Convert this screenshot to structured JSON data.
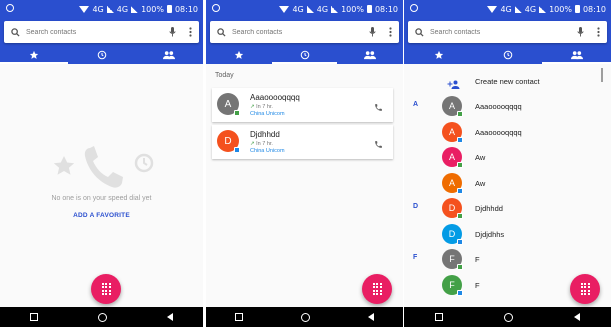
{
  "screens": {
    "speed_dial": {
      "status": {
        "network1": "4G",
        "network2": "4G",
        "battery": "100%",
        "time": "08:10"
      },
      "search": {
        "placeholder": "Search contacts"
      },
      "empty_message": "No one is on your speed dial yet",
      "add_favorite": "ADD A FAVORITE"
    },
    "recents": {
      "status": {
        "network1": "4G",
        "network2": "4G",
        "battery": "100%",
        "time": "08:10"
      },
      "search": {
        "placeholder": "Search contacts"
      },
      "section_label": "Today",
      "calls": [
        {
          "initial": "A",
          "name": "Aaaooooqqqq",
          "meta": "In 7 hr.",
          "carrier": "China Unicom",
          "avatar_color": "#757575"
        },
        {
          "initial": "D",
          "name": "Djdhhdd",
          "meta": "In 7 hr.",
          "carrier": "China Unicom",
          "avatar_color": "#f4511e"
        }
      ]
    },
    "contacts": {
      "status": {
        "network1": "4G",
        "network2": "4G",
        "battery": "100%",
        "time": "08:10"
      },
      "search": {
        "placeholder": "Search contacts"
      },
      "create_label": "Create new contact",
      "rows": [
        {
          "letter": "A",
          "initial": "A",
          "name": "Aaaooooqqqq",
          "avatar_color": "#757575"
        },
        {
          "letter": "",
          "initial": "A",
          "name": "Aaaooooqqqq",
          "avatar_color": "#f4511e"
        },
        {
          "letter": "",
          "initial": "A",
          "name": "Aw",
          "avatar_color": "#e91e63"
        },
        {
          "letter": "",
          "initial": "A",
          "name": "Aw",
          "avatar_color": "#ef6c00"
        },
        {
          "letter": "D",
          "initial": "D",
          "name": "Djdhhdd",
          "avatar_color": "#f4511e"
        },
        {
          "letter": "",
          "initial": "D",
          "name": "Djdjdhhs",
          "avatar_color": "#039be5"
        },
        {
          "letter": "F",
          "initial": "F",
          "name": "F",
          "avatar_color": "#757575"
        },
        {
          "letter": "",
          "initial": "F",
          "name": "F",
          "avatar_color": "#43a047"
        }
      ]
    }
  },
  "colors": {
    "primary": "#2a4fcf",
    "fab": "#e91e63",
    "badge_green": "#43a047",
    "badge_blue": "#1e88e5"
  },
  "icons": [
    "search-icon",
    "mic-icon",
    "more-vert-icon",
    "star-icon",
    "clock-icon",
    "people-icon",
    "phone-icon",
    "add-person-icon",
    "dialpad-icon"
  ]
}
